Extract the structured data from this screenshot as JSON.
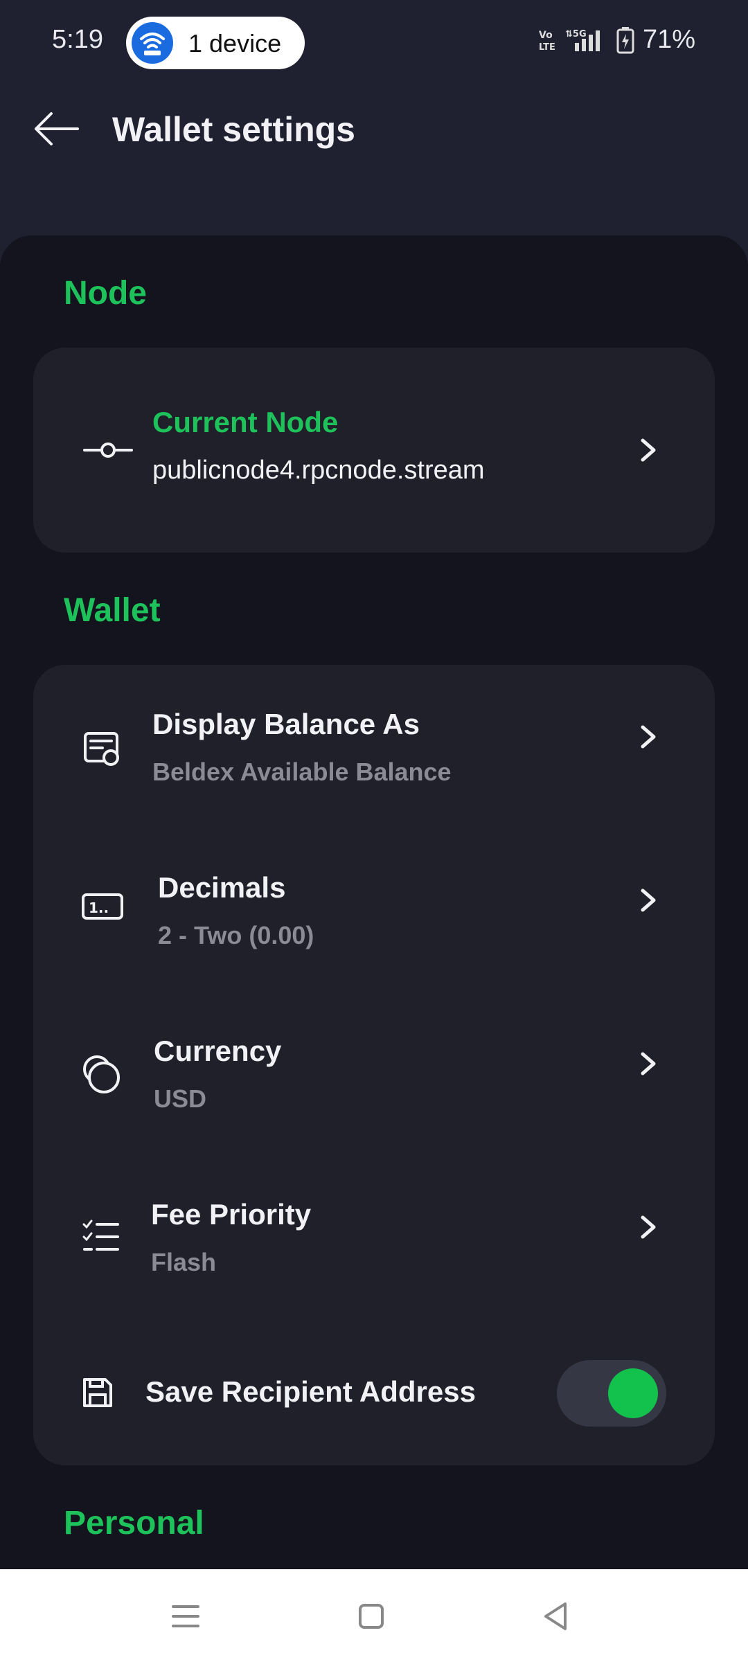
{
  "status_bar": {
    "time": "5:19",
    "hotspot_label": "1 device",
    "battery": "71%",
    "icons": [
      "volte-icon",
      "5g-signal-icon",
      "battery-charging-icon"
    ]
  },
  "header": {
    "title": "Wallet settings",
    "back_icon": "arrow-left-icon"
  },
  "sections": {
    "node": {
      "title": "Node",
      "current_node": {
        "title": "Current Node",
        "value": "publicnode4.rpcnode.stream",
        "icon": "node-commit-icon"
      }
    },
    "wallet": {
      "title": "Wallet",
      "items": [
        {
          "title": "Display Balance As",
          "value": "Beldex Available Balance",
          "icon": "balance-card-icon"
        },
        {
          "title": "Decimals",
          "value": "2 - Two (0.00)",
          "icon": "decimals-icon"
        },
        {
          "title": "Currency",
          "value": "USD",
          "icon": "currency-coins-icon"
        },
        {
          "title": "Fee Priority",
          "value": "Flash",
          "icon": "checklist-icon"
        }
      ],
      "save_recipient": {
        "title": "Save Recipient Address",
        "enabled": true,
        "icon": "save-floppy-icon"
      }
    },
    "personal": {
      "title": "Personal"
    }
  },
  "colors": {
    "accent_green": "#1ec25a",
    "background": "#13141d",
    "card": "#1f2029",
    "header_bg": "#1f2030"
  },
  "nav_bar": {
    "icons": [
      "menu-icon",
      "home-square-icon",
      "back-triangle-icon"
    ]
  }
}
